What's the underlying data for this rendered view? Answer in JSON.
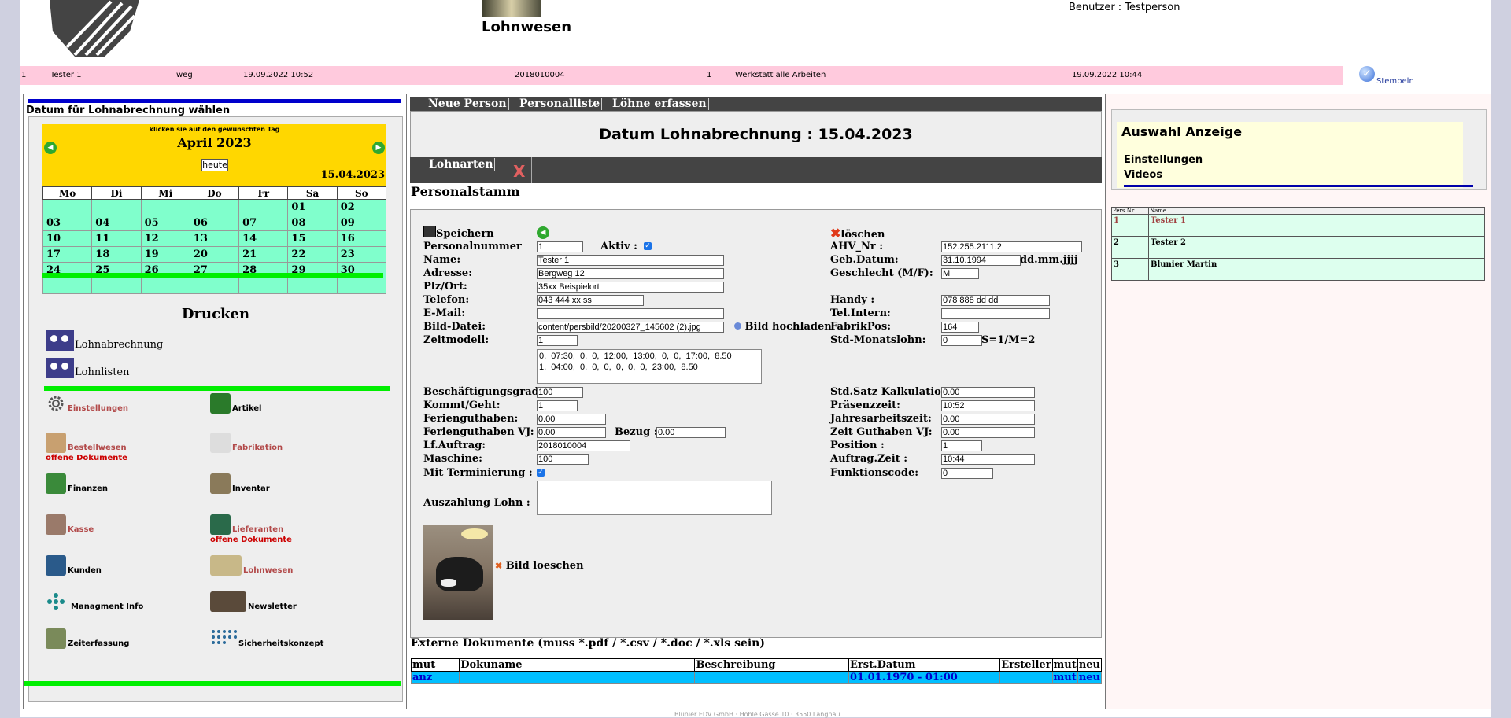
{
  "header": {
    "title": "Lohnwesen",
    "user": "Benutzer : Testperson"
  },
  "statusbar": {
    "cols": [
      "1",
      "Tester 1",
      "weg",
      "19.09.2022 10:52",
      "2018010004",
      "1",
      "Werkstatt alle Arbeiten",
      "19.09.2022 10:44"
    ],
    "stempeln": "Stempeln"
  },
  "left": {
    "title": "Datum für Lohnabrechnung wählen",
    "calendar": {
      "hint": "klicken sie auf den gewünschten Tag",
      "month": "April 2023",
      "today_button": "heute",
      "selected": "15.04.2023",
      "weekdays": [
        "Mo",
        "Di",
        "Mi",
        "Do",
        "Fr",
        "Sa",
        "So"
      ],
      "weeks": [
        [
          "",
          "",
          "",
          "",
          "",
          "01",
          "02"
        ],
        [
          "03",
          "04",
          "05",
          "06",
          "07",
          "08",
          "09"
        ],
        [
          "10",
          "11",
          "12",
          "13",
          "14",
          "15",
          "16"
        ],
        [
          "17",
          "18",
          "19",
          "20",
          "21",
          "22",
          "23"
        ],
        [
          "24",
          "25",
          "26",
          "27",
          "28",
          "29",
          "30"
        ],
        [
          "",
          "",
          "",
          "",
          "",
          "",
          ""
        ]
      ]
    },
    "drucken": "Drucken",
    "print_items": [
      "Lohnabrechnung",
      "Lohnlisten"
    ],
    "menu": {
      "einstellungen": "Einstellungen",
      "artikel": "Artikel",
      "bestellwesen": "Bestellwesen",
      "bestellwesen_sub": "offene Dokumente",
      "fabrikation": "Fabrikation",
      "finanzen": "Finanzen",
      "inventar": "Inventar",
      "kasse": "Kasse",
      "lieferanten": "Lieferanten",
      "lieferanten_sub": "offene Dokumente",
      "kunden": "Kunden",
      "lohnwesen": "Lohnwesen",
      "managment": "Managment Info",
      "newsletter": "Newsletter",
      "zeiterfassung": "Zeiterfassung",
      "sicherheit": "Sicherheitskonzept"
    }
  },
  "center": {
    "nav": [
      "Neue Person",
      "Personalliste",
      "Löhne erfassen"
    ],
    "date_title": "Datum Lohnabrechnung : 15.04.2023",
    "lohnarten": "Lohnarten",
    "close_x": "X",
    "section": "Personalstamm",
    "save": "Speichern",
    "delete": "löschen",
    "labels": {
      "personalnummer": "Personalnummer",
      "aktiv": "Aktiv :",
      "name": "Name:",
      "adresse": "Adresse:",
      "plz": "Plz/Ort:",
      "telefon": "Telefon:",
      "email": "E-Mail:",
      "bilddatei": "Bild-Datei:",
      "bild_hochladen": "Bild hochladen",
      "zeitmodell": "Zeitmodell:",
      "ahv": "AHV_Nr :",
      "geb": "Geb.Datum:",
      "geb_format": "dd.mm.jjjj",
      "geschlecht": "Geschlecht (M/F):",
      "handy": "Handy :",
      "telintern": "Tel.Intern:",
      "fabrikpos": "FabrikPos:",
      "stdmonat": "Std-Monatslohn:",
      "stdmonat_hint": "S=1/M=2",
      "beschaeftigung": "Beschäftigungsgrad:",
      "kommt": "Kommt/Geht:",
      "ferien": "Ferienguthaben:",
      "ferien_vj": "Ferienguthaben VJ:",
      "bezug": "Bezug :",
      "lfauftrag": "Lf.Auftrag:",
      "maschine": "Maschine:",
      "termin": "Mit Terminierung :",
      "auszahlung": "Auszahlung Lohn :",
      "stdsatz": "Std.Satz Kalkulation:",
      "praesenz": "Präsenzzeit:",
      "jahresarbeit": "Jahresarbeitszeit:",
      "zeitguthaben": "Zeit Guthaben VJ:",
      "position": "Position :",
      "auftragzeit": "Auftrag.Zeit :",
      "funktion": "Funktionscode:",
      "bild_loeschen": "Bild loeschen"
    },
    "values": {
      "personalnummer": "1",
      "name": "Tester 1",
      "adresse": "Bergweg 12",
      "plz": "35xx Beispielort",
      "telefon": "043 444 xx ss",
      "email": "",
      "bilddatei": "content/persbild/20200327_145602 (2).jpg",
      "zeitmodell": "1",
      "zeitmodell_text": "0,  07:30,  0,  0,  12:00,  13:00,  0,  0,  17:00,  8.50\n1,  04:00,  0,  0,  0,  0,  0,  0,  23:00,  8.50",
      "ahv": "152.255.2111.2",
      "geb": "31.10.1994",
      "geschlecht": "M",
      "handy": "078 888 dd dd",
      "telintern": "",
      "fabrikpos": "164",
      "stdmonat": "0",
      "beschaeftigung": "100",
      "kommt": "1",
      "ferien": "0.00",
      "ferien_vj": "0.00",
      "bezug": "0.00",
      "lfauftrag": "2018010004",
      "maschine": "100",
      "auszahlung": "",
      "stdsatz": "0.00",
      "praesenz": "10:52",
      "jahresarbeit": "0.00",
      "zeitguthaben": "0.00",
      "position": "1",
      "auftragzeit": "10:44",
      "funktion": "0"
    },
    "ext_title": "Externe Dokumente (muss *.pdf / *.csv / *.doc / *.xls sein)",
    "ext_headers": [
      "mut",
      "Dokuname",
      "Beschreibung",
      "Erst.Datum",
      "Ersteller",
      "mut",
      "neu"
    ],
    "ext_row": [
      "anz",
      "",
      "",
      "01.01.1970 - 01:00",
      "",
      "mut",
      "neu"
    ]
  },
  "right": {
    "title": "Auswahl Anzeige",
    "items": [
      "Einstellungen",
      "Videos"
    ],
    "table_headers": [
      "Pers.Nr",
      "Name"
    ],
    "rows": [
      {
        "nr": "1",
        "name": "Tester 1"
      },
      {
        "nr": "2",
        "name": "Tester 2"
      },
      {
        "nr": "3",
        "name": "Blunier Martin"
      }
    ]
  },
  "footer": "Blunier EDV GmbH · Hohle Gasse 10 · 3550 Langnau"
}
